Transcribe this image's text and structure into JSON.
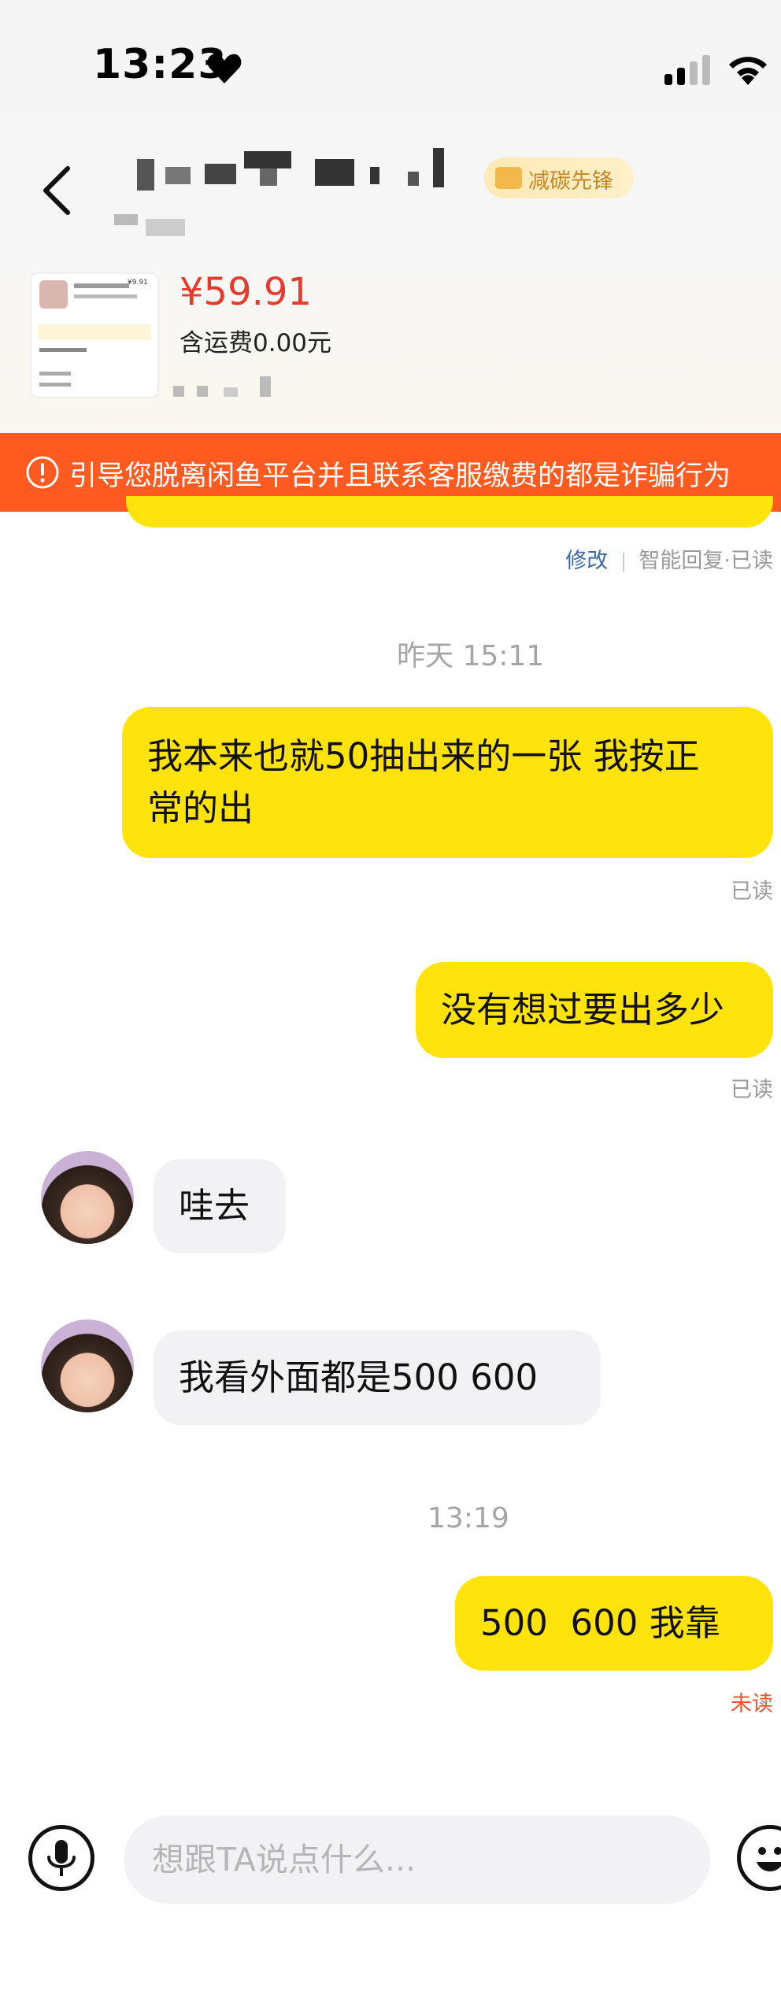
{
  "status_bar": {
    "time": "13:23"
  },
  "header": {
    "badge_text": "减碳先锋"
  },
  "product": {
    "price": "¥59.91",
    "shipping": "含运费0.00元",
    "thumb_price": "¥9.91"
  },
  "warning": {
    "text": "引导您脱离闲鱼平台并且联系客服缴费的都是诈骗行为"
  },
  "chat": {
    "reply_meta": {
      "edit": "修改",
      "rest": "智能回复·已读"
    },
    "time_1": "昨天 15:11",
    "msg_1_line1": "我本来也就50抽出来的一张 我按正",
    "msg_1_line2": "常的出",
    "msg_1_status": "已读",
    "msg_2": "没有想过要出多少",
    "msg_2_status": "已读",
    "msg_3": "哇去",
    "msg_4": "我看外面都是500 600",
    "time_2": "13:19",
    "msg_5": "500  600 我靠",
    "msg_5_status": "未读"
  },
  "input": {
    "placeholder": "想跟TA说点什么..."
  },
  "colors": {
    "accent": "#ffe30a",
    "price": "#e53b2a",
    "banner": "#ff5a1f",
    "unread": "#e8542c"
  },
  "icons": [
    "heart-icon",
    "signal-icon",
    "wifi-icon",
    "back-icon",
    "warning-icon",
    "mic-icon",
    "emoji-icon"
  ]
}
